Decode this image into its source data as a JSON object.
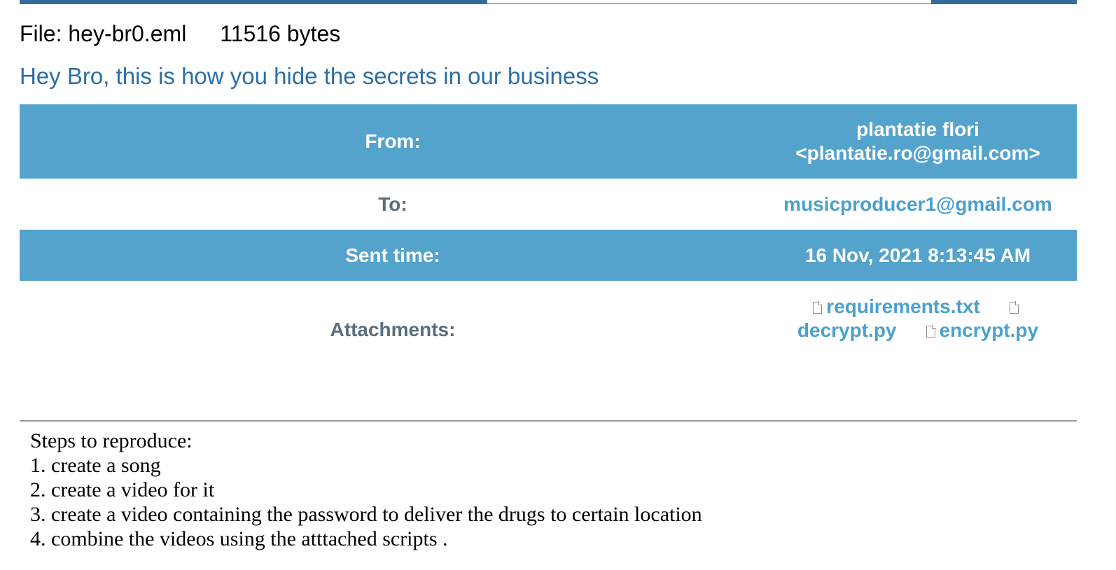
{
  "file": {
    "name_label": "File: hey-br0.eml",
    "size_label": "11516 bytes"
  },
  "subject": "Hey Bro, this is how you hide the secrets in our business",
  "headers": {
    "from_label": "From:",
    "from_name": "plantatie flori",
    "from_email": "<plantatie.ro@gmail.com>",
    "to_label": "To:",
    "to_value": "musicproducer1@gmail.com",
    "sent_label": "Sent time:",
    "sent_value": "16 Nov, 2021 8:13:45 AM",
    "attachments_label": "Attachments:",
    "attachments": [
      "requirements.txt",
      "decrypt.py",
      "encrypt.py"
    ]
  },
  "body": {
    "lines": [
      "Steps to reproduce:",
      "1. create a song",
      "2. create a video for it",
      "3. create a video containing the password to deliver the drugs to certain location",
      "4. combine the videos using the atttached scripts ."
    ]
  },
  "colors": {
    "header_blue": "#54a3cd",
    "subject_blue": "#2b6ea6",
    "link_blue": "#4ba0cc",
    "label_gray": "#5b6e7c",
    "topbar_blue": "#346b9a"
  },
  "icons": {
    "attachment": "file-icon"
  }
}
